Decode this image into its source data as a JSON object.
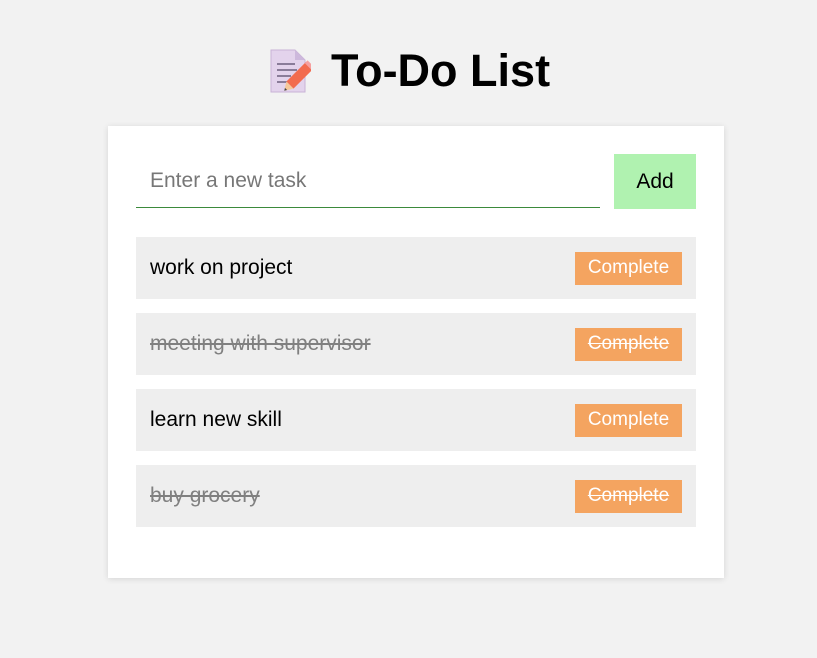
{
  "header": {
    "icon": "memo-pencil-icon",
    "title": "To-Do List"
  },
  "input": {
    "placeholder": "Enter a new task",
    "value": "",
    "add_label": "Add"
  },
  "colors": {
    "background": "#f2f2f2",
    "card": "#ffffff",
    "add_button": "#b0f2b0",
    "complete_button": "#f4a460",
    "task_bg": "#eeeeee",
    "input_underline": "#3b8a3b"
  },
  "tasks": [
    {
      "text": "work on project",
      "completed": false,
      "button_label": "Complete"
    },
    {
      "text": "meeting with supervisor",
      "completed": true,
      "button_label": "Complete"
    },
    {
      "text": "learn new skill",
      "completed": false,
      "button_label": "Complete"
    },
    {
      "text": "buy grocery",
      "completed": true,
      "button_label": "Complete"
    }
  ]
}
